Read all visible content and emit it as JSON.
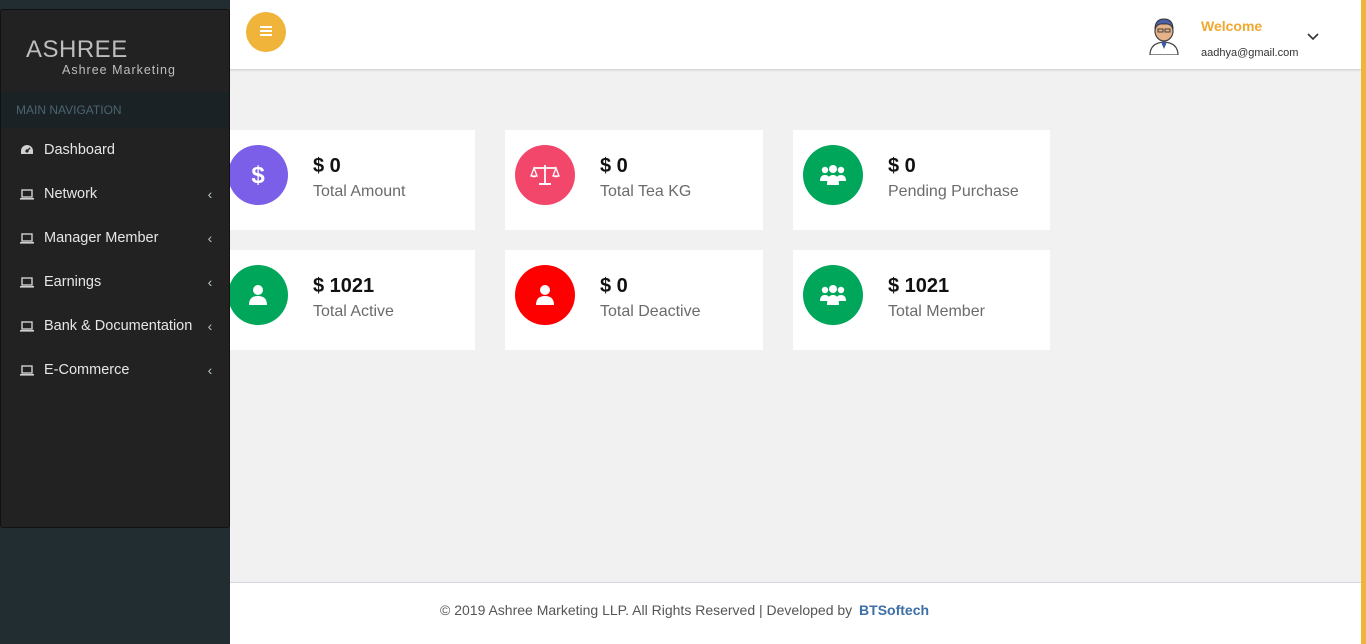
{
  "brand": {
    "title": "ASHREE",
    "subtitle": "Ashree Marketing"
  },
  "sidebar": {
    "header": "MAIN NAVIGATION",
    "items": [
      {
        "label": "Dashboard",
        "icon": "dashboard-icon",
        "has_children": false
      },
      {
        "label": "Network",
        "icon": "laptop-icon",
        "has_children": true
      },
      {
        "label": "Manager Member",
        "icon": "laptop-icon",
        "has_children": true
      },
      {
        "label": "Earnings",
        "icon": "laptop-icon",
        "has_children": true
      },
      {
        "label": "Bank & Documentation",
        "icon": "laptop-icon",
        "has_children": true
      },
      {
        "label": "E-Commerce",
        "icon": "laptop-icon",
        "has_children": true
      }
    ]
  },
  "header": {
    "welcome": "Welcome",
    "email": "aadhya@gmail.com"
  },
  "cards": [
    {
      "value": "$ 0",
      "label": "Total Amount",
      "icon": "dollar-icon",
      "color": "#7b5fe8"
    },
    {
      "value": "$ 0",
      "label": "Total Tea KG",
      "icon": "scale-icon",
      "color": "#f2476a"
    },
    {
      "value": "$ 0",
      "label": "Pending Purchase",
      "icon": "users-icon",
      "color": "#00a65a"
    },
    {
      "value": "$ 1021",
      "label": "Total Active",
      "icon": "user-icon",
      "color": "#00a65a"
    },
    {
      "value": "$ 0",
      "label": "Total Deactive",
      "icon": "user-icon",
      "color": "#ff0000"
    },
    {
      "value": "$ 1021",
      "label": "Total Member",
      "icon": "users-icon",
      "color": "#00a65a"
    }
  ],
  "footer": {
    "text": "© 2019 Ashree Marketing LLP. All Rights Reserved | Developed by",
    "link": "BTSoftech"
  },
  "colors": {
    "accent": "#f0b43a",
    "sidebar_bg": "#222222",
    "footer_link": "#3c6fa8"
  }
}
